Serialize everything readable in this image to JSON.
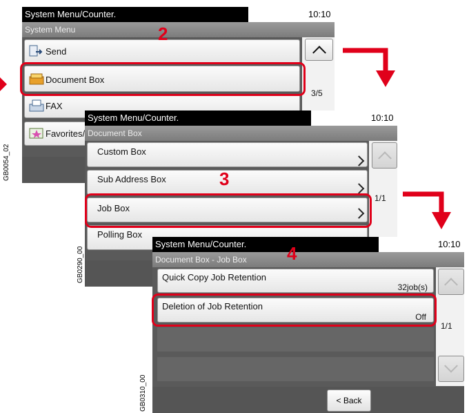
{
  "screen1": {
    "header": "System Menu/Counter.",
    "time": "10:10",
    "title": "System Menu",
    "items": [
      {
        "label": "Send",
        "icon": "send-icon"
      },
      {
        "label": "Document Box",
        "icon": "document-box-icon"
      },
      {
        "label": "FAX",
        "icon": "fax-icon"
      },
      {
        "label": "Favorites/",
        "icon": "favorites-icon"
      }
    ],
    "page": "3/5",
    "code": "GB0054_02"
  },
  "screen2": {
    "header": "System Menu/Counter.",
    "time": "10:10",
    "title": "Document Box",
    "items": [
      {
        "label": "Custom Box"
      },
      {
        "label": "Sub Address Box"
      },
      {
        "label": "Job Box"
      },
      {
        "label": "Polling Box"
      }
    ],
    "page": "1/1",
    "code": "GB0290_00"
  },
  "screen3": {
    "header": "System Menu/Counter.",
    "time": "10:10",
    "title": "Document Box - Job Box",
    "items": [
      {
        "label": "Quick Copy Job Retention",
        "value": "32job(s)"
      },
      {
        "label": "Deletion of Job Retention",
        "value": "Off"
      }
    ],
    "page": "1/1",
    "back": "< Back",
    "code": "GB0310_00"
  },
  "steps": {
    "s2": "2",
    "s3": "3",
    "s4": "4"
  },
  "colors": {
    "highlight": "#e0001a"
  }
}
